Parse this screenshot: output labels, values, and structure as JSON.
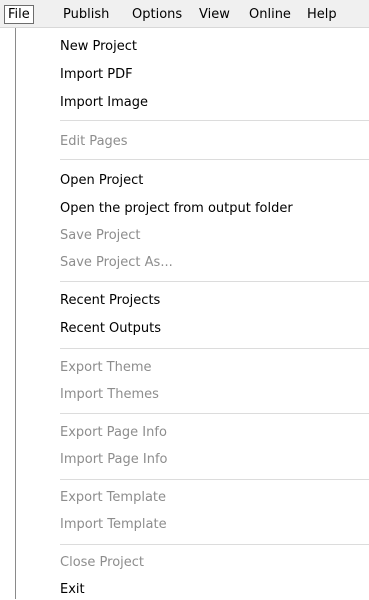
{
  "menubar": {
    "items": [
      {
        "label": "File",
        "active": true
      },
      {
        "label": "Publish"
      },
      {
        "label": "Options"
      },
      {
        "label": "View"
      },
      {
        "label": "Online"
      },
      {
        "label": "Help"
      }
    ]
  },
  "file_menu": {
    "items": [
      {
        "label": "New Project",
        "enabled": true
      },
      {
        "label": "Import PDF",
        "enabled": true
      },
      {
        "label": "Import Image",
        "enabled": true
      },
      {
        "label": "Edit Pages",
        "enabled": false
      },
      {
        "label": "Open Project",
        "enabled": true
      },
      {
        "label": "Open the project from output folder",
        "enabled": true
      },
      {
        "label": "Save Project",
        "enabled": false
      },
      {
        "label": "Save Project As...",
        "enabled": false
      },
      {
        "label": "Recent Projects",
        "enabled": true
      },
      {
        "label": "Recent Outputs",
        "enabled": true
      },
      {
        "label": "Export Theme",
        "enabled": false
      },
      {
        "label": "Import Themes",
        "enabled": false
      },
      {
        "label": "Export Page Info",
        "enabled": false
      },
      {
        "label": "Import Page Info",
        "enabled": false
      },
      {
        "label": "Export Template",
        "enabled": false
      },
      {
        "label": "Import Template",
        "enabled": false
      },
      {
        "label": "Close Project",
        "enabled": false
      },
      {
        "label": "Exit",
        "enabled": true
      }
    ]
  }
}
